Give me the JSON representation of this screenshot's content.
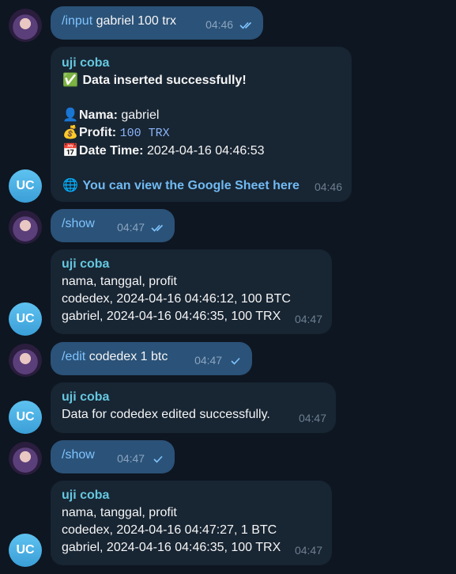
{
  "sender_name": "uji coba",
  "bot_avatar_initials": "UC",
  "messages": [
    {
      "cmd": "/input",
      "rest": "gabriel 100 trx",
      "time": "04:46"
    },
    {
      "status": "Data inserted successfully!",
      "nama_label": "Nama:",
      "nama_value": "gabriel",
      "profit_label": "Profit:",
      "profit_value": "100 TRX",
      "date_label": "Date Time:",
      "date_value": "2024-04-16 04:46:53",
      "link": "You can view the Google Sheet here",
      "time": "04:46"
    },
    {
      "cmd": "/show",
      "rest": "",
      "time": "04:47"
    },
    {
      "lines": [
        "nama, tanggal, profit",
        "codedex, 2024-04-16 04:46:12, 100 BTC",
        "gabriel, 2024-04-16 04:46:35, 100 TRX"
      ],
      "time": "04:47"
    },
    {
      "cmd": "/edit",
      "rest": "codedex 1 btc",
      "time": "04:47"
    },
    {
      "text": "Data for codedex edited successfully.",
      "time": "04:47"
    },
    {
      "cmd": "/show",
      "rest": "",
      "time": "04:47"
    },
    {
      "lines": [
        "nama, tanggal, profit",
        "codedex, 2024-04-16 04:47:27, 1 BTC",
        "gabriel, 2024-04-16 04:46:35, 100 TRX"
      ],
      "time": "04:47"
    }
  ],
  "colors": {
    "outgoing": "#2b5278",
    "incoming": "#182533",
    "background": "#0e1621",
    "accent": "#65c7df"
  }
}
